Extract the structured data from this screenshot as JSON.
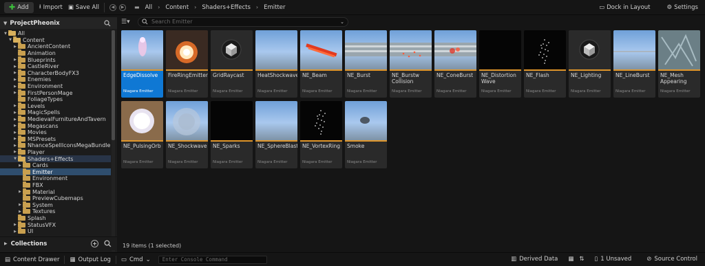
{
  "toolbar": {
    "add_label": "Add",
    "import_label": "Import",
    "save_all_label": "Save All",
    "breadcrumbs": [
      "All",
      "Content",
      "Shaders+Effects",
      "Emitter"
    ],
    "dock_label": "Dock in Layout",
    "settings_label": "Settings"
  },
  "sidebar": {
    "project": "ProjectPheonix",
    "tree": [
      {
        "label": "All",
        "depth": 0,
        "arrow": "▼",
        "open": true
      },
      {
        "label": "Content",
        "depth": 1,
        "arrow": "▼",
        "open": true
      },
      {
        "label": "AncientContent",
        "depth": 2,
        "arrow": "▶"
      },
      {
        "label": "Animation",
        "depth": 2,
        "arrow": ""
      },
      {
        "label": "Blueprints",
        "depth": 2,
        "arrow": "▶"
      },
      {
        "label": "CastleRiver",
        "depth": 2,
        "arrow": "▶"
      },
      {
        "label": "CharacterBodyFX3",
        "depth": 2,
        "arrow": "▶"
      },
      {
        "label": "Enemies",
        "depth": 2,
        "arrow": "▶"
      },
      {
        "label": "Environment",
        "depth": 2,
        "arrow": "▶"
      },
      {
        "label": "FirstPersonMage",
        "depth": 2,
        "arrow": "▶"
      },
      {
        "label": "FoliageTypes",
        "depth": 2,
        "arrow": ""
      },
      {
        "label": "Levels",
        "depth": 2,
        "arrow": "▶"
      },
      {
        "label": "MagicSpells",
        "depth": 2,
        "arrow": "▶"
      },
      {
        "label": "MedievalFurnitureAndTavern",
        "depth": 2,
        "arrow": "▶"
      },
      {
        "label": "Megascans",
        "depth": 2,
        "arrow": "▶"
      },
      {
        "label": "Movies",
        "depth": 2,
        "arrow": "▶"
      },
      {
        "label": "MSPresets",
        "depth": 2,
        "arrow": "▶"
      },
      {
        "label": "NhanceSpellIconsMegaBundle",
        "depth": 2,
        "arrow": "▶"
      },
      {
        "label": "Player",
        "depth": 2,
        "arrow": "▶"
      },
      {
        "label": "Shaders+Effects",
        "depth": 2,
        "arrow": "▼",
        "open": true,
        "hl": true
      },
      {
        "label": "Cards",
        "depth": 3,
        "arrow": "▶"
      },
      {
        "label": "Emitter",
        "depth": 3,
        "arrow": "",
        "selected": true
      },
      {
        "label": "Environment",
        "depth": 3,
        "arrow": ""
      },
      {
        "label": "FBX",
        "depth": 3,
        "arrow": ""
      },
      {
        "label": "Material",
        "depth": 3,
        "arrow": "▶"
      },
      {
        "label": "PreviewCubemaps",
        "depth": 3,
        "arrow": ""
      },
      {
        "label": "System",
        "depth": 3,
        "arrow": "▶"
      },
      {
        "label": "Textures",
        "depth": 3,
        "arrow": "▶"
      },
      {
        "label": "Splash",
        "depth": 2,
        "arrow": ""
      },
      {
        "label": "StatusVFX",
        "depth": 2,
        "arrow": "▶"
      },
      {
        "label": "UI",
        "depth": 2,
        "arrow": "▶"
      }
    ],
    "collections_label": "Collections"
  },
  "content": {
    "search_placeholder": "Search Emitter",
    "items_count": "19 items (1 selected)",
    "assets": [
      {
        "name": "EdgeDissolve",
        "type": "Niagara Emitter",
        "thumb": "edge",
        "selected": true
      },
      {
        "name": "FireRingEmitter",
        "type": "Niagara Emitter",
        "thumb": "firering"
      },
      {
        "name": "GridRaycast",
        "type": "Niagara Emitter",
        "thumb": "cube"
      },
      {
        "name": "HeatShockwave",
        "type": "Niagara Emitter",
        "thumb": "sky"
      },
      {
        "name": "NE_Beam",
        "type": "Niagara Emitter",
        "thumb": "beam"
      },
      {
        "name": "NE_Burst",
        "type": "Niagara Emitter",
        "thumb": "building"
      },
      {
        "name": "NE_Burstw Collision",
        "type": "Niagara Emitter",
        "thumb": "building2"
      },
      {
        "name": "NE_ConeBurst",
        "type": "Niagara Emitter",
        "thumb": "building3"
      },
      {
        "name": "NE_Distortion Wave",
        "type": "Niagara Emitter",
        "thumb": "black"
      },
      {
        "name": "NE_Flash",
        "type": "Niagara Emitter",
        "thumb": "sparkles"
      },
      {
        "name": "NE_Lighting",
        "type": "Niagara Emitter",
        "thumb": "cube"
      },
      {
        "name": "NE_LineBurst",
        "type": "Niagara Emitter",
        "thumb": "sky2"
      },
      {
        "name": "NE_Mesh Appearing",
        "type": "Niagara Emitter",
        "thumb": "mesh"
      },
      {
        "name": "NE_PulsingOrb",
        "type": "Niagara Emitter",
        "thumb": "orb"
      },
      {
        "name": "NE_Shockwave",
        "type": "Niagara Emitter",
        "thumb": "shock"
      },
      {
        "name": "NE_Sparks",
        "type": "Niagara Emitter",
        "thumb": "black"
      },
      {
        "name": "NE_SphereBlast",
        "type": "Niagara Emitter",
        "thumb": "sky"
      },
      {
        "name": "NE_VortexRing",
        "type": "Niagara Emitter",
        "thumb": "sparkles"
      },
      {
        "name": "Smoke",
        "type": "Niagara Emitter",
        "thumb": "smoke"
      }
    ]
  },
  "statusbar": {
    "content_drawer": "Content Drawer",
    "output_log": "Output Log",
    "cmd": "Cmd",
    "console_placeholder": "Enter Console Command",
    "derived_data": "Derived Data",
    "unsaved": "1 Unsaved",
    "source_control": "Source Control"
  }
}
